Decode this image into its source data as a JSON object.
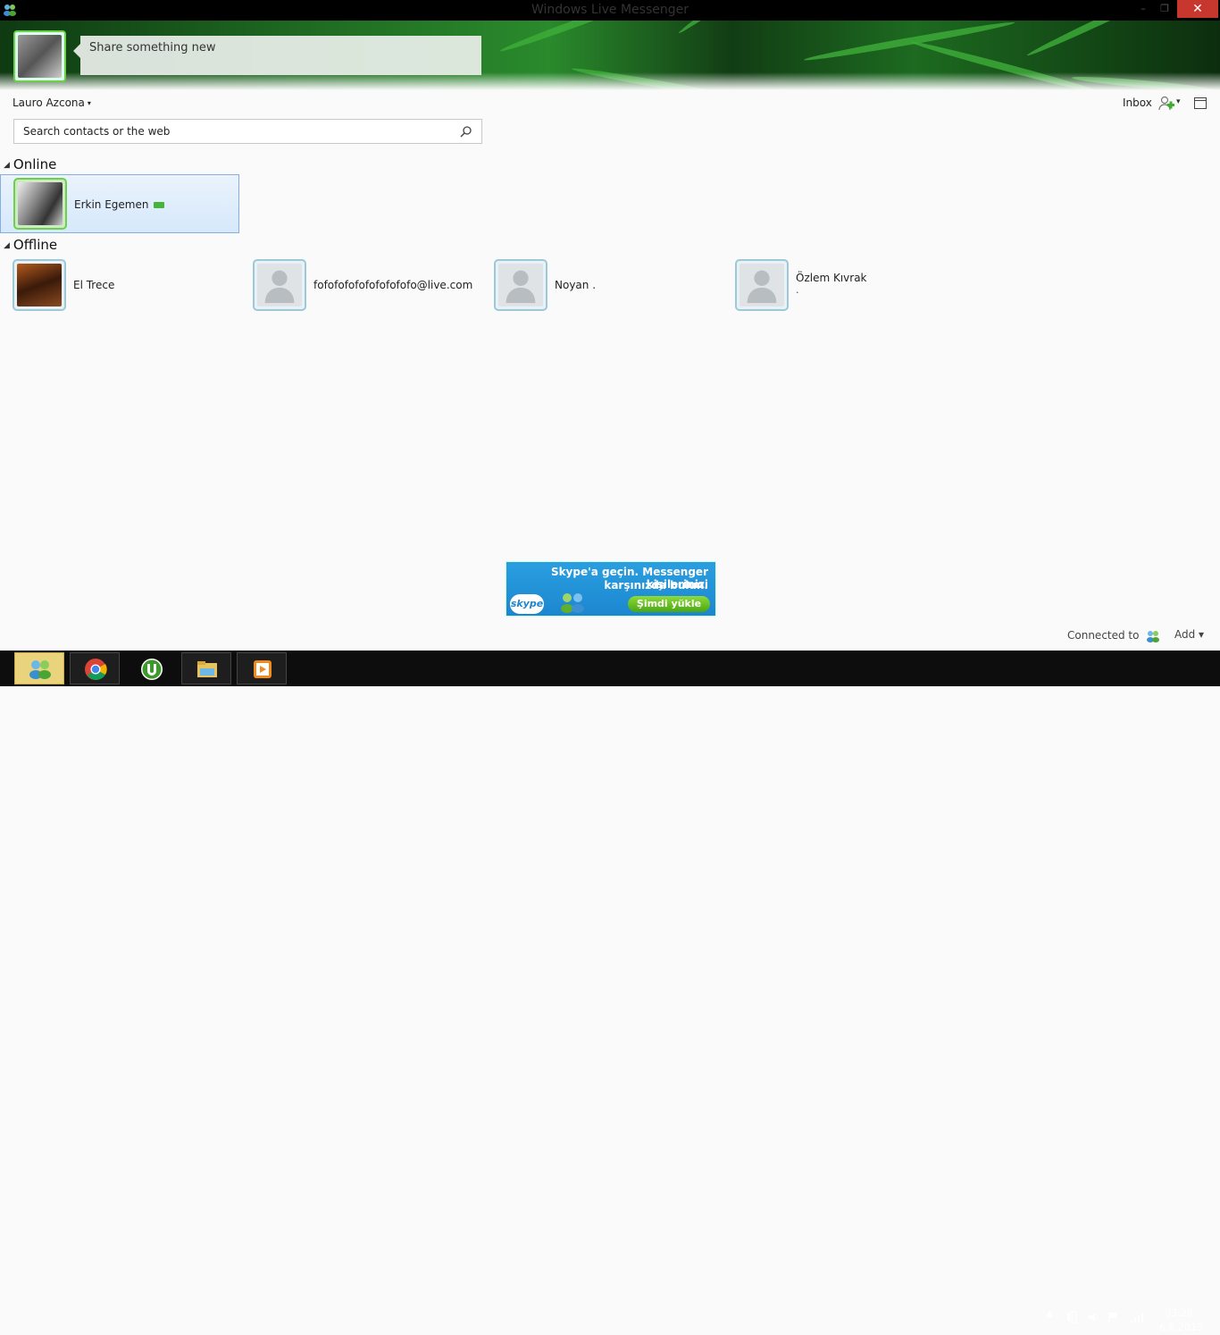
{
  "window": {
    "title": "Windows Live Messenger",
    "min": "–",
    "max": "❐",
    "close": "✕"
  },
  "share": {
    "placeholder": "Share something new"
  },
  "user": {
    "name": "Lauro Azcona",
    "caret": "▾"
  },
  "toolbar": {
    "inbox": "Inbox",
    "add_contact_caret": "▾"
  },
  "search": {
    "placeholder": "Search contacts or the web"
  },
  "groups": {
    "online": {
      "label": "Online",
      "toggle": "◢"
    },
    "offline": {
      "label": "Offline",
      "toggle": "◢"
    }
  },
  "contacts": {
    "online": [
      {
        "name": "Erkin Egemen",
        "video": true
      }
    ],
    "offline": [
      {
        "name": "El Trece",
        "sub": ""
      },
      {
        "name": "fofofofofofofofofofo@live.com",
        "sub": ""
      },
      {
        "name": "Noyan .",
        "sub": ""
      },
      {
        "name": "Özlem Kıvrak",
        "sub": "."
      }
    ]
  },
  "ad": {
    "line1": "Skype'a geçin. Messenger kişilerinizi",
    "line2": "karşınızda bulun.",
    "logo": "skype",
    "cta": "Şimdi yükle"
  },
  "footer": {
    "connected_to": "Connected to",
    "add": "Add ▾"
  },
  "taskbar": {
    "apps": [
      "messenger-icon",
      "chrome-icon",
      "utorrent-icon",
      "file-explorer-icon",
      "media-player-icon"
    ],
    "tray_up": "▲",
    "time": "03:28",
    "date": "6.8.2013"
  }
}
